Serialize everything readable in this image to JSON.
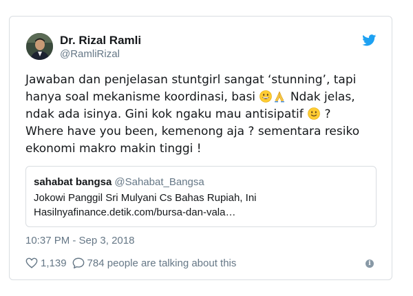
{
  "author": {
    "display_name": "Dr. Rizal Ramli",
    "handle": "@RamliRizal",
    "avatar_icon": "avatar-photo",
    "brand_icon": "twitter-bird-icon"
  },
  "tweet": {
    "part1": "Jawaban dan penjelasan stuntgirl sangat ‘stunning’, tapi hanya soal mekanisme koordinasi, basi",
    "emoji1": "grinning-face-emoji",
    "emoji2": "folded-hands-emoji",
    "part2": " Ndak jelas, ndak ada isinya. Gini kok ngaku mau antisipatif",
    "emoji3": "slightly-smiling-face-emoji",
    "part3": " ?  Where have you been,  kemenong aja ? sementara resiko ekonomi makro makin tinggi !"
  },
  "quote": {
    "name": "sahabat bangsa",
    "handle": "@Sahabat_Bangsa",
    "line1": "Jokowi Panggil Sri Mulyani Cs Bahas Rupiah, Ini",
    "line2": "Hasilnyafinance.detik.com/bursa-dan-vala…"
  },
  "timestamp": "10:37 PM - Sep 3, 2018",
  "actions": {
    "likes": "1,139",
    "talking": "784 people are talking about this"
  },
  "colors": {
    "accent": "#1da1f2",
    "muted": "#657786",
    "border": "#d9dde1"
  }
}
